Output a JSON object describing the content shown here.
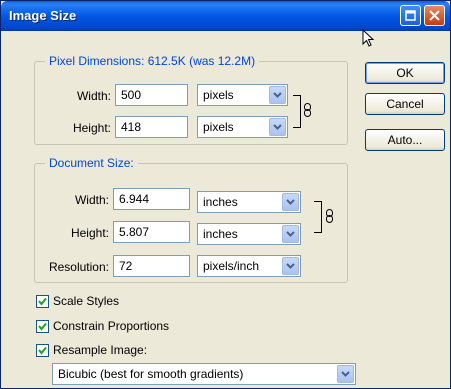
{
  "window": {
    "title": "Image Size"
  },
  "pixel_dimensions": {
    "legend": "Pixel Dimensions:  612.5K (was 12.2M)",
    "width_label": "Width:",
    "width_value": "500",
    "width_unit": "pixels",
    "height_label": "Height:",
    "height_value": "418",
    "height_unit": "pixels"
  },
  "document_size": {
    "legend": "Document Size:",
    "width_label": "Width:",
    "width_value": "6.944",
    "width_unit": "inches",
    "height_label": "Height:",
    "height_value": "5.807",
    "height_unit": "inches",
    "resolution_label": "Resolution:",
    "resolution_value": "72",
    "resolution_unit": "pixels/inch"
  },
  "buttons": {
    "ok": "OK",
    "cancel": "Cancel",
    "auto": "Auto..."
  },
  "options": {
    "scale_styles": "Scale Styles",
    "constrain_proportions": "Constrain Proportions",
    "resample_image": "Resample Image:",
    "resample_method": "Bicubic (best for smooth gradients)"
  },
  "colors": {
    "titlebar": "#0058e6",
    "legend_text": "#0046d5",
    "dialog_bg": "#ece9d8"
  }
}
